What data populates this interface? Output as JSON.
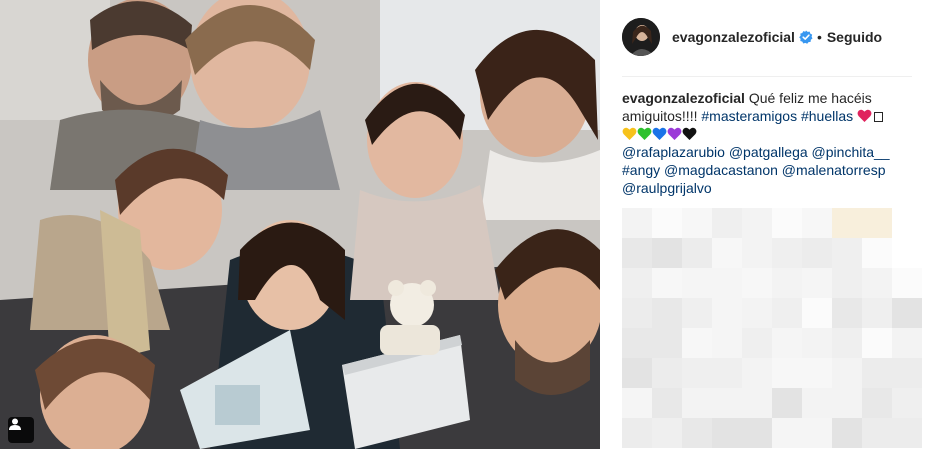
{
  "post": {
    "username": "evagonzalezoficial",
    "separator": "•",
    "follow_status": "Seguido",
    "verified": true,
    "caption": {
      "username": "evagonzalezoficial",
      "text_1": "Qué feliz me hacéis amiguitos!!!!",
      "hashtag_1": "#masteramigos",
      "hashtag_2": "#huellas",
      "mentions": [
        "@rafaplazarubio",
        "@patgallega",
        "@pinchita__",
        "#angy",
        "@magdacastanon",
        "@malenatorresp",
        "@raulpgrijalvo"
      ]
    },
    "comments_blurred": true
  },
  "colors": {
    "link": "#003569",
    "verified_blue": "#3897f0",
    "text": "#262626",
    "divider": "#efefef"
  },
  "icons": {
    "user_tag": "user-silhouette-icon",
    "verified": "verified-badge-icon"
  }
}
